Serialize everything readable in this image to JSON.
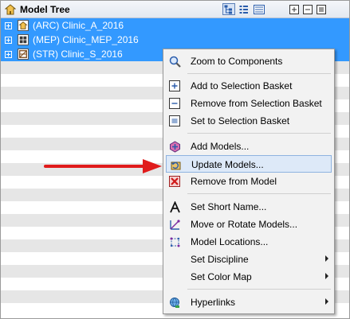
{
  "panel": {
    "title": "Model Tree",
    "toolbar": [
      {
        "icon": "hierarchy-view-icon",
        "active": true
      },
      {
        "icon": "flat-view-icon",
        "active": false
      },
      {
        "icon": "list-view-icon",
        "active": false
      },
      {
        "icon": "expand-all-icon",
        "active": false
      },
      {
        "icon": "collapse-all-icon",
        "active": false
      },
      {
        "icon": "select-all-icon",
        "active": false
      }
    ]
  },
  "tree": {
    "items": [
      {
        "label": "(ARC) Clinic_A_2016",
        "icon": "architectural-model-icon",
        "selected": true
      },
      {
        "label": "(MEP) Clinic_MEP_2016",
        "icon": "mep-model-icon",
        "selected": true
      },
      {
        "label": "(STR) Clinic_S_2016",
        "icon": "structural-model-icon",
        "selected": true
      }
    ]
  },
  "context_menu": {
    "items": [
      {
        "label": "Zoom to Components",
        "icon": "magnifier-icon"
      },
      {
        "label": "Add to Selection Basket",
        "icon": "add-basket-icon"
      },
      {
        "label": "Remove from Selection Basket",
        "icon": "remove-basket-icon"
      },
      {
        "label": "Set to Selection Basket",
        "icon": "set-basket-icon"
      },
      {
        "label": "Add Models...",
        "icon": "add-models-icon"
      },
      {
        "label": "Update Models...",
        "icon": "update-models-icon",
        "highlighted": true
      },
      {
        "label": "Remove from Model",
        "icon": "remove-model-icon"
      },
      {
        "label": "Set Short Name...",
        "icon": "letter-a-icon"
      },
      {
        "label": "Move or Rotate Models...",
        "icon": "move-rotate-icon"
      },
      {
        "label": "Model Locations...",
        "icon": "model-locations-icon"
      },
      {
        "label": "Set Discipline",
        "icon": "",
        "submenu": true
      },
      {
        "label": "Set Color Map",
        "icon": "",
        "submenu": true
      },
      {
        "label": "Hyperlinks",
        "icon": "globe-link-icon",
        "submenu": true
      }
    ]
  },
  "colors": {
    "selection": "#3399ff",
    "stripe": "#e6e6e6",
    "menu_bg": "#f2f2f2",
    "menu_highlight": "#dde9f8",
    "annotation_arrow": "#e01b1b"
  }
}
